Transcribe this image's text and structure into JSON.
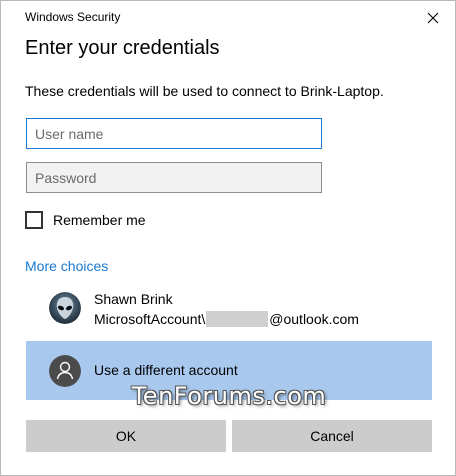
{
  "window": {
    "title": "Windows Security"
  },
  "dialog": {
    "heading": "Enter your credentials",
    "description": "These credentials will be used to connect to Brink-Laptop."
  },
  "fields": {
    "username_placeholder": "User name",
    "username_value": "",
    "password_placeholder": "Password",
    "password_value": ""
  },
  "remember": {
    "label": "Remember me",
    "checked": false
  },
  "more_choices": {
    "label": "More choices"
  },
  "accounts": [
    {
      "name": "Shawn Brink",
      "email_prefix": "MicrosoftAccount\\",
      "email_suffix": "@outlook.com"
    },
    {
      "name": "Use a different account",
      "selected": true
    }
  ],
  "watermark": "TenForums.com",
  "buttons": {
    "ok": "OK",
    "cancel": "Cancel"
  },
  "colors": {
    "accent": "#1979d2",
    "selected_row": "#a9c8ee",
    "button_bg": "#cccccc"
  },
  "icons": {
    "close": "close-icon",
    "alien_avatar": "alien-avatar-icon",
    "generic_user": "person-icon"
  }
}
